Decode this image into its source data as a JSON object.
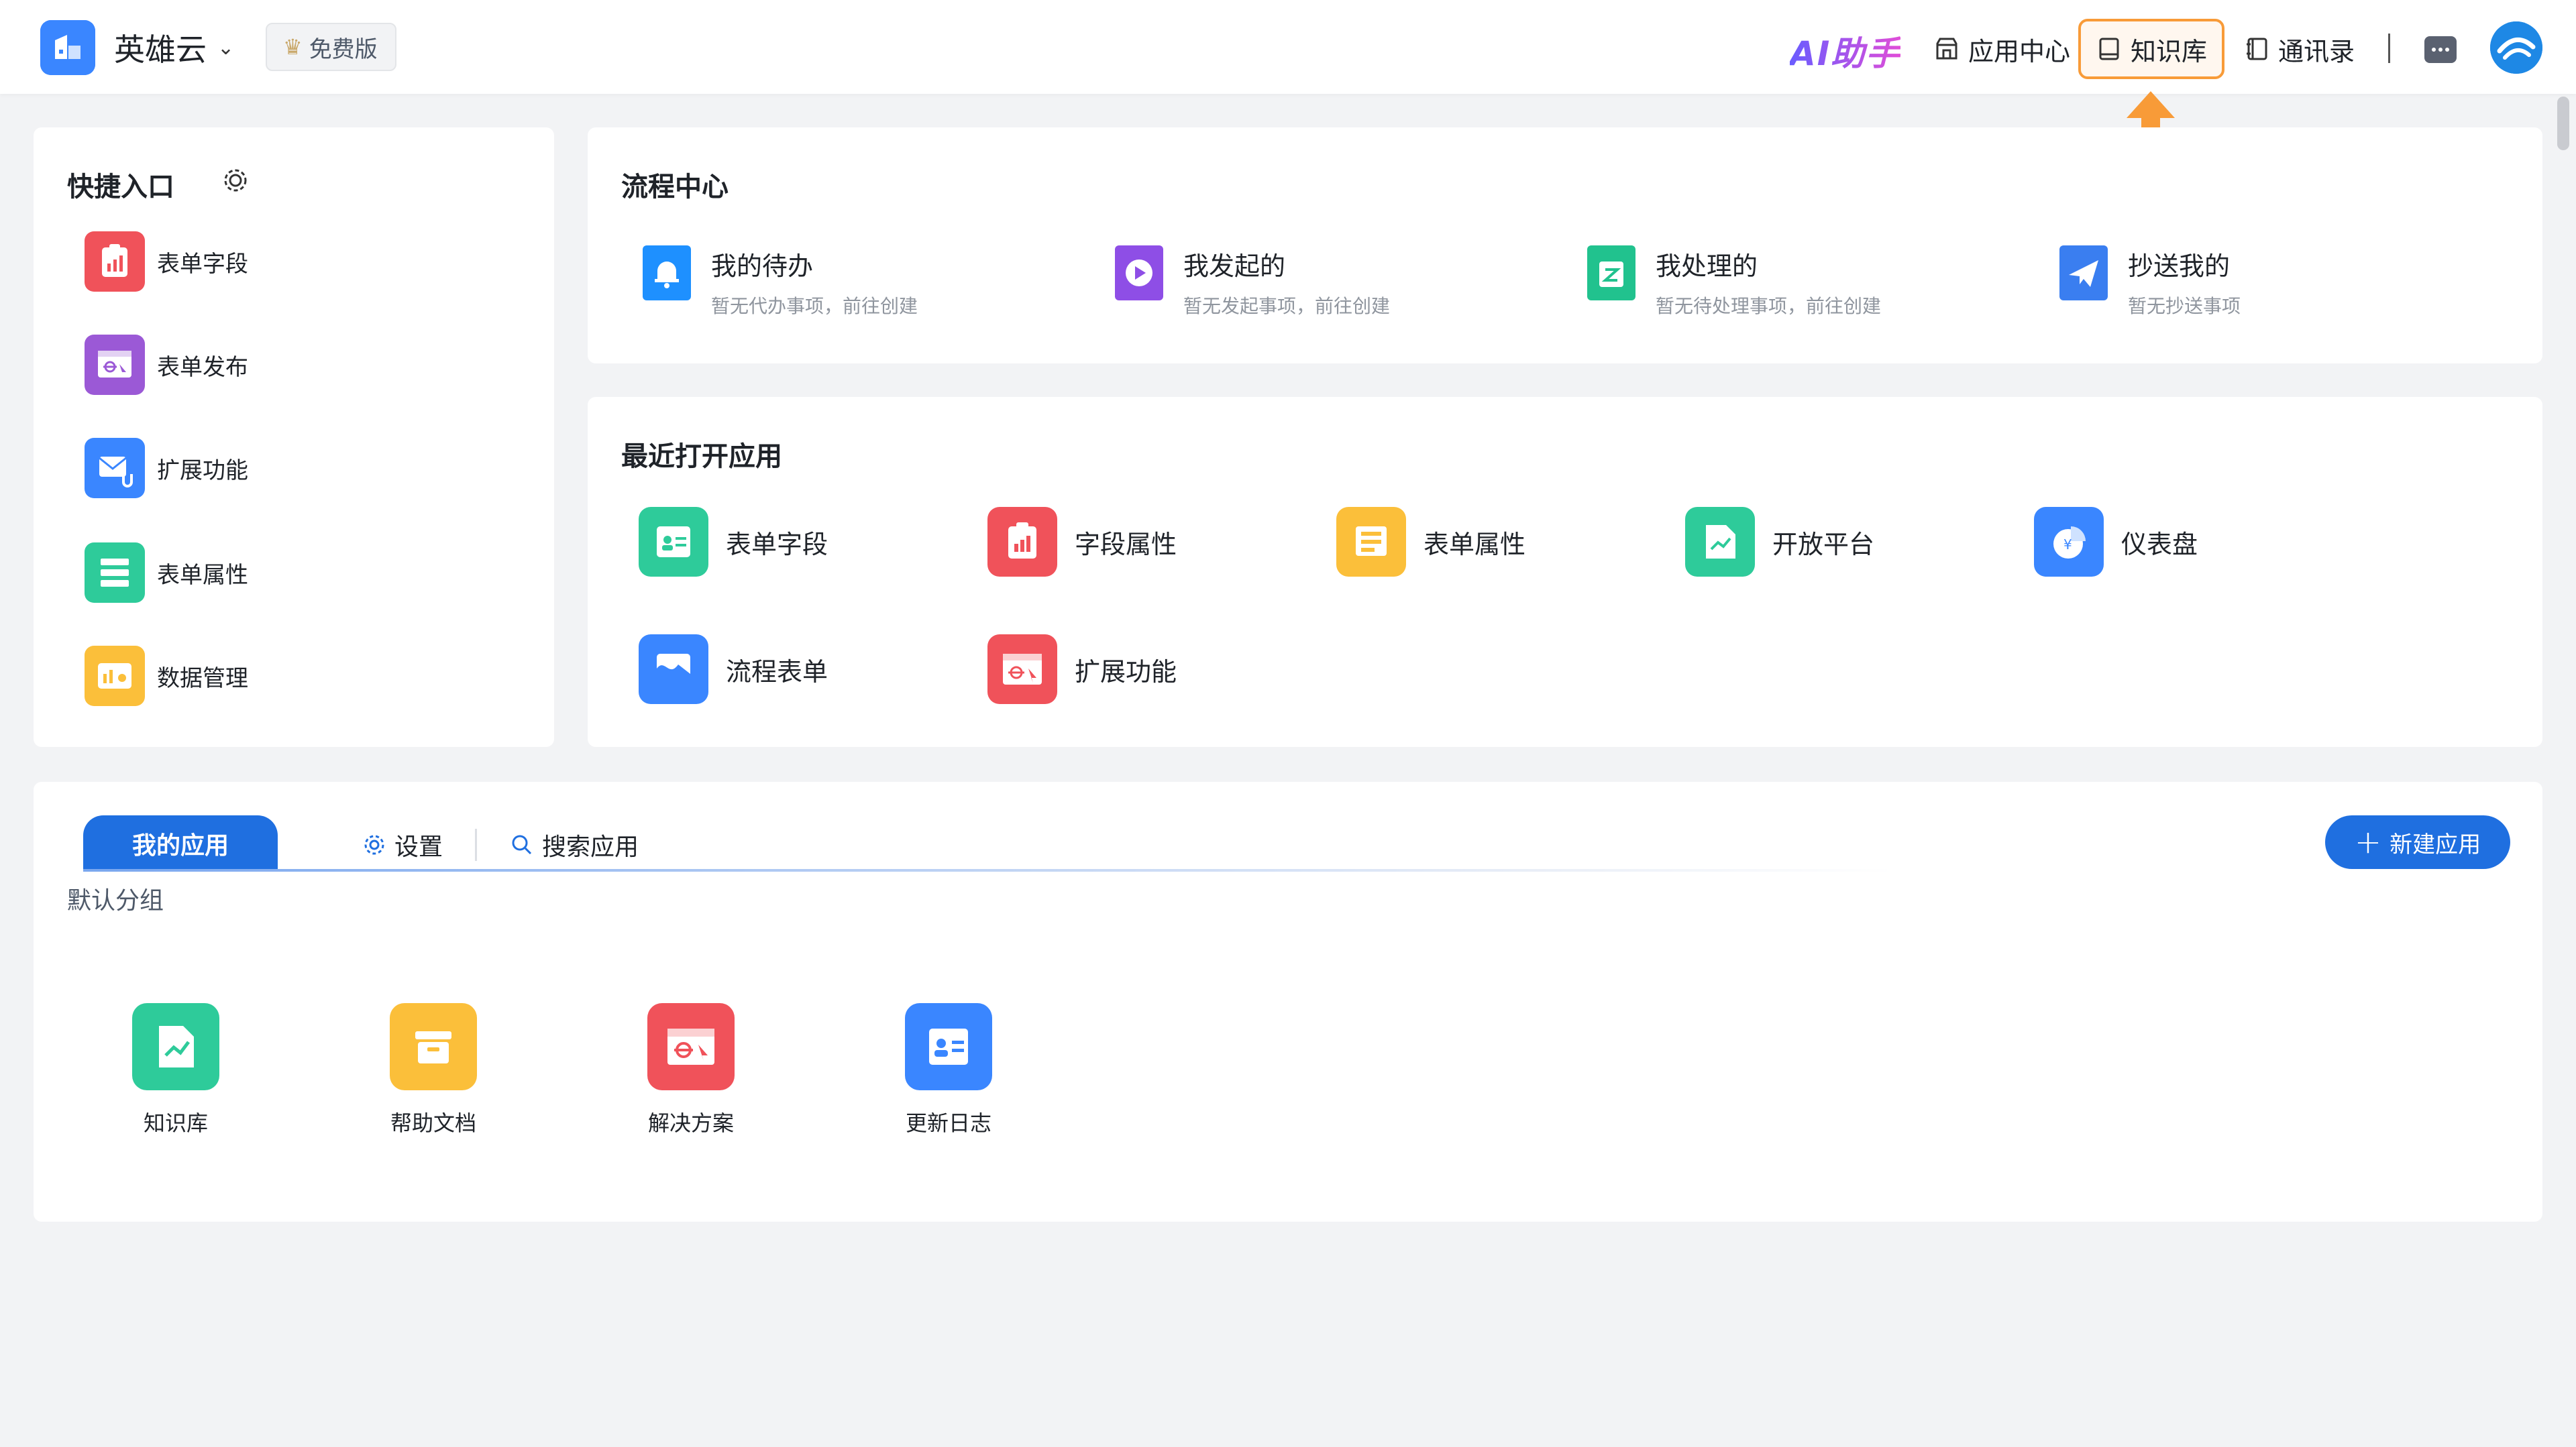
{
  "header": {
    "brand": "英雄云",
    "plan": "免费版",
    "ai_label": "AI助手",
    "nav": [
      {
        "label": "应用中心",
        "icon": "store-icon"
      },
      {
        "label": "知识库",
        "icon": "book-icon",
        "active": true
      },
      {
        "label": "通讯录",
        "icon": "contacts-icon"
      }
    ],
    "accent_color": "#f89b38"
  },
  "quick": {
    "title": "快捷入口",
    "items": [
      {
        "label": "表单字段",
        "color": "#f0525a"
      },
      {
        "label": "表单发布",
        "color": "#9b59d6"
      },
      {
        "label": "扩展功能",
        "color": "#3a86ff"
      },
      {
        "label": "表单属性",
        "color": "#2ecb9a"
      },
      {
        "label": "数据管理",
        "color": "#fbbf3a"
      }
    ]
  },
  "process": {
    "title": "流程中心",
    "items": [
      {
        "title": "我的待办",
        "subtitle": "暂无代办事项，前往创建",
        "color": "#1e90ff"
      },
      {
        "title": "我发起的",
        "subtitle": "暂无发起事项，前往创建",
        "color": "#8e4ee6"
      },
      {
        "title": "我处理的",
        "subtitle": "暂无待处理事项，前往创建",
        "color": "#21c28e"
      },
      {
        "title": "抄送我的",
        "subtitle": "暂无抄送事项",
        "color": "#3a7ef0"
      }
    ]
  },
  "recent": {
    "title": "最近打开应用",
    "items": [
      {
        "label": "表单字段",
        "color": "#2ecb9a"
      },
      {
        "label": "字段属性",
        "color": "#f0525a"
      },
      {
        "label": "表单属性",
        "color": "#fbbf3a"
      },
      {
        "label": "开放平台",
        "color": "#2ecb9a"
      },
      {
        "label": "仪表盘",
        "color": "#3a86ff"
      },
      {
        "label": "流程表单",
        "color": "#3a86ff"
      },
      {
        "label": "扩展功能",
        "color": "#f0525a"
      }
    ]
  },
  "apps": {
    "tab_active": "我的应用",
    "tab_settings": "设置",
    "tab_search": "搜索应用",
    "new_button": "新建应用",
    "group": "默认分组",
    "items": [
      {
        "label": "知识库",
        "color": "#2ecb9a"
      },
      {
        "label": "帮助文档",
        "color": "#fbbf3a"
      },
      {
        "label": "解决方案",
        "color": "#f0525a"
      },
      {
        "label": "更新日志",
        "color": "#3a86ff"
      }
    ]
  }
}
